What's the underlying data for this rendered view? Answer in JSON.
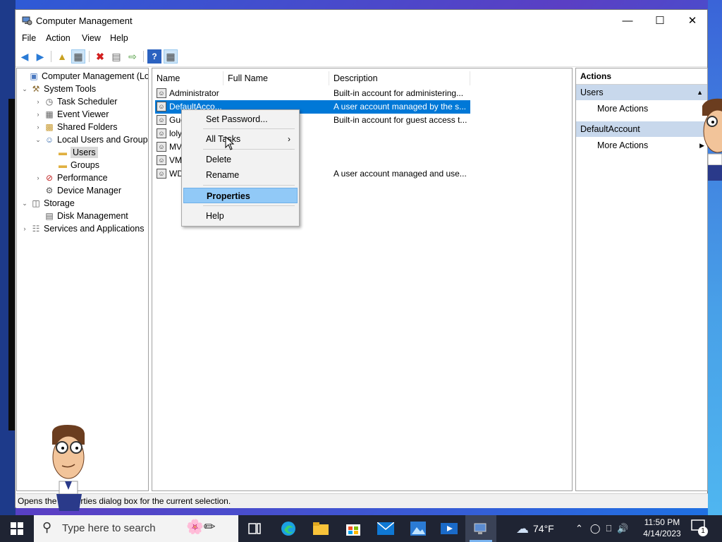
{
  "window": {
    "title": "Computer Management",
    "controls": {
      "minimize": "—",
      "maximize": "☐",
      "close": "✕"
    }
  },
  "menu": [
    "File",
    "Action",
    "View",
    "Help"
  ],
  "tree": {
    "items": [
      {
        "label": "Computer Management (Local",
        "level": 0,
        "expander": ""
      },
      {
        "label": "System Tools",
        "level": 1,
        "expander": "⌄"
      },
      {
        "label": "Task Scheduler",
        "level": 2,
        "expander": "›"
      },
      {
        "label": "Event Viewer",
        "level": 2,
        "expander": "›"
      },
      {
        "label": "Shared Folders",
        "level": 2,
        "expander": "›"
      },
      {
        "label": "Local Users and Groups",
        "level": 2,
        "expander": "⌄"
      },
      {
        "label": "Users",
        "level": 3,
        "expander": "",
        "selected": true
      },
      {
        "label": "Groups",
        "level": 3,
        "expander": ""
      },
      {
        "label": "Performance",
        "level": 2,
        "expander": "›"
      },
      {
        "label": "Device Manager",
        "level": 2,
        "expander": ""
      },
      {
        "label": "Storage",
        "level": 1,
        "expander": "⌄"
      },
      {
        "label": "Disk Management",
        "level": 2,
        "expander": ""
      },
      {
        "label": "Services and Applications",
        "level": 1,
        "expander": "›"
      }
    ]
  },
  "list": {
    "columns": [
      "Name",
      "Full Name",
      "Description"
    ],
    "rows": [
      {
        "name": "Administrator",
        "full_name": "",
        "description": "Built-in account for administering..."
      },
      {
        "name": "DefaultAcco...",
        "full_name": "",
        "description": "A user account managed by the s...",
        "selected": true
      },
      {
        "name": "Gue",
        "full_name": "",
        "description": "Built-in account for guest access t..."
      },
      {
        "name": "loly",
        "full_name": "",
        "description": ""
      },
      {
        "name": "MV",
        "full_name": "",
        "description": ""
      },
      {
        "name": "VM",
        "full_name": "",
        "description": ""
      },
      {
        "name": "WD",
        "full_name": "",
        "description": "A user account managed and use..."
      }
    ]
  },
  "context_menu": {
    "items": [
      "Set Password...",
      "All Tasks",
      "Delete",
      "Rename",
      "Properties",
      "Help"
    ],
    "submenu_arrow": "›"
  },
  "actions": {
    "header": "Actions",
    "sections": [
      {
        "title": "Users",
        "items": [
          "More Actions"
        ]
      },
      {
        "title": "DefaultAccount",
        "items": [
          "More Actions"
        ]
      }
    ]
  },
  "status": {
    "text": "Opens the properties dialog box for the current selection."
  },
  "taskbar": {
    "search_placeholder": "Type here to search",
    "weather": "74°F",
    "time": "11:50 PM",
    "date": "4/14/2023",
    "notification_count": "1"
  },
  "colors": {
    "selection": "#0078d7",
    "menu_highlight": "#91c9f7",
    "taskbar": "#1f2433"
  }
}
